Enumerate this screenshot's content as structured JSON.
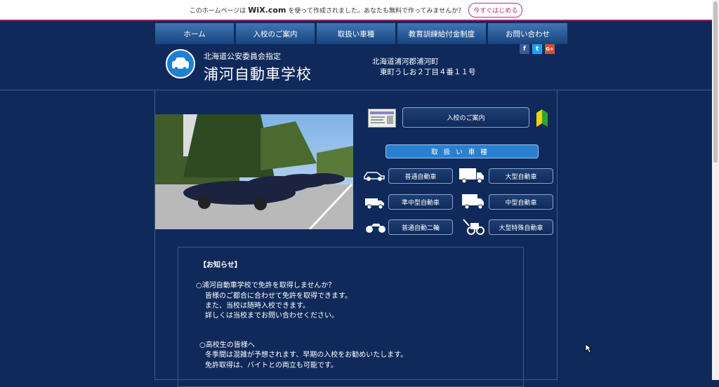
{
  "wix_banner": {
    "text_before": "このホームページは",
    "brand": "WiX.com",
    "text_after": "を使って作成されました。あなたも無料で作ってみませんか？",
    "cta_label": "今すぐはじめる"
  },
  "nav": {
    "items": [
      {
        "label": "ホーム"
      },
      {
        "label": "入校のご案内"
      },
      {
        "label": "取扱い車種"
      },
      {
        "label": "教育訓練給付金制度"
      },
      {
        "label": "お問い合わせ"
      }
    ]
  },
  "header": {
    "subtitle": "北海道公安委員会指定",
    "title": "浦河自動車学校",
    "address_line1": "北海道浦河郡浦河町",
    "address_line2": "東町うしお２丁目４番１１号"
  },
  "social": {
    "facebook": "f",
    "twitter": "t",
    "googleplus": "G+"
  },
  "main": {
    "admission_button": "入校のご案内",
    "vehicles_heading": "取扱い車種",
    "vehicles": [
      {
        "label": "普通自動車",
        "icon": "car-icon"
      },
      {
        "label": "大型自動車",
        "icon": "large-truck-icon"
      },
      {
        "label": "準中型自動車",
        "icon": "small-truck-icon"
      },
      {
        "label": "中型自動車",
        "icon": "medium-truck-icon"
      },
      {
        "label": "普通自動二輪",
        "icon": "motorcycle-icon"
      },
      {
        "label": "大型特殊自動車",
        "icon": "special-vehicle-icon"
      }
    ]
  },
  "notice": {
    "heading": "【お知らせ】",
    "item1_title": "○浦河自動車学校で免許を取得しませんか？",
    "item1_lines": [
      "皆様のご都合に合わせて免許を取得できます。",
      "また、当校は随時入校できます。",
      "詳しくは当校までお問い合わせください。"
    ],
    "item2_title": "○高校生の皆様へ",
    "item2_lines": [
      "冬季間は混雑が予想されます、早期の入校をお勧めいたします。",
      "免許取得は、バイトとの両立も可能です。"
    ]
  },
  "colors": {
    "page_bg": "#0f2a5a",
    "nav_top": "#3f76b5",
    "accent_blue": "#2b7fd1",
    "wix_pink": "#b0317e"
  }
}
